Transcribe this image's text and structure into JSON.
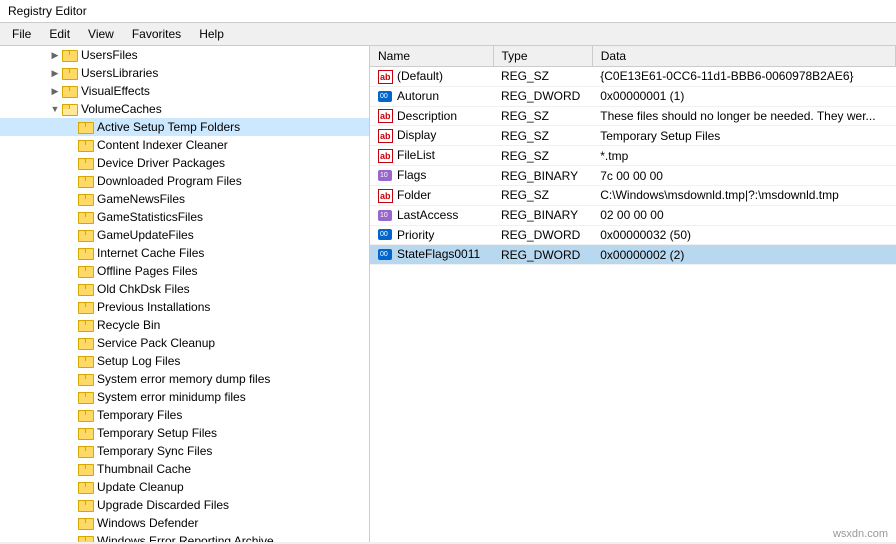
{
  "titleBar": {
    "title": "Registry Editor"
  },
  "menuBar": {
    "items": [
      "File",
      "Edit",
      "View",
      "Favorites",
      "Help"
    ]
  },
  "treePanel": {
    "items": [
      {
        "label": "UsersFiles",
        "indent": 3,
        "arrow": "▶",
        "selected": false
      },
      {
        "label": "UsersLibraries",
        "indent": 3,
        "arrow": "▶",
        "selected": false
      },
      {
        "label": "VisualEffects",
        "indent": 3,
        "arrow": "▶",
        "selected": false
      },
      {
        "label": "VolumeCaches",
        "indent": 3,
        "arrow": "▼",
        "selected": false,
        "open": true
      },
      {
        "label": "Active Setup Temp Folders",
        "indent": 4,
        "arrow": "",
        "selected": true
      },
      {
        "label": "Content Indexer Cleaner",
        "indent": 4,
        "arrow": "",
        "selected": false
      },
      {
        "label": "Device Driver Packages",
        "indent": 4,
        "arrow": "",
        "selected": false
      },
      {
        "label": "Downloaded Program Files",
        "indent": 4,
        "arrow": "",
        "selected": false
      },
      {
        "label": "GameNewsFiles",
        "indent": 4,
        "arrow": "",
        "selected": false
      },
      {
        "label": "GameStatisticsFiles",
        "indent": 4,
        "arrow": "",
        "selected": false
      },
      {
        "label": "GameUpdateFiles",
        "indent": 4,
        "arrow": "",
        "selected": false
      },
      {
        "label": "Internet Cache Files",
        "indent": 4,
        "arrow": "",
        "selected": false
      },
      {
        "label": "Offline Pages Files",
        "indent": 4,
        "arrow": "",
        "selected": false
      },
      {
        "label": "Old ChkDsk Files",
        "indent": 4,
        "arrow": "",
        "selected": false
      },
      {
        "label": "Previous Installations",
        "indent": 4,
        "arrow": "",
        "selected": false
      },
      {
        "label": "Recycle Bin",
        "indent": 4,
        "arrow": "",
        "selected": false
      },
      {
        "label": "Service Pack Cleanup",
        "indent": 4,
        "arrow": "",
        "selected": false
      },
      {
        "label": "Setup Log Files",
        "indent": 4,
        "arrow": "",
        "selected": false
      },
      {
        "label": "System error memory dump files",
        "indent": 4,
        "arrow": "",
        "selected": false
      },
      {
        "label": "System error minidump files",
        "indent": 4,
        "arrow": "",
        "selected": false
      },
      {
        "label": "Temporary Files",
        "indent": 4,
        "arrow": "",
        "selected": false
      },
      {
        "label": "Temporary Setup Files",
        "indent": 4,
        "arrow": "",
        "selected": false
      },
      {
        "label": "Temporary Sync Files",
        "indent": 4,
        "arrow": "",
        "selected": false
      },
      {
        "label": "Thumbnail Cache",
        "indent": 4,
        "arrow": "",
        "selected": false
      },
      {
        "label": "Update Cleanup",
        "indent": 4,
        "arrow": "",
        "selected": false
      },
      {
        "label": "Upgrade Discarded Files",
        "indent": 4,
        "arrow": "",
        "selected": false
      },
      {
        "label": "Windows Defender",
        "indent": 4,
        "arrow": "",
        "selected": false
      },
      {
        "label": "Windows Error Reporting Archive",
        "indent": 4,
        "arrow": "",
        "selected": false
      }
    ]
  },
  "registryTable": {
    "headers": [
      "Name",
      "Type",
      "Data"
    ],
    "rows": [
      {
        "name": "(Default)",
        "type": "REG_SZ",
        "data": "{C0E13E61-0CC6-11d1-BBB6-0060978B2AE6}",
        "iconType": "sz",
        "selected": false
      },
      {
        "name": "Autorun",
        "type": "REG_DWORD",
        "data": "0x00000001 (1)",
        "iconType": "dword",
        "selected": false
      },
      {
        "name": "Description",
        "type": "REG_SZ",
        "data": "These files should no longer be needed. They wer...",
        "iconType": "sz",
        "selected": false
      },
      {
        "name": "Display",
        "type": "REG_SZ",
        "data": "Temporary Setup Files",
        "iconType": "sz",
        "selected": false
      },
      {
        "name": "FileList",
        "type": "REG_SZ",
        "data": "*.tmp",
        "iconType": "sz",
        "selected": false
      },
      {
        "name": "Flags",
        "type": "REG_BINARY",
        "data": "7c 00 00 00",
        "iconType": "binary",
        "selected": false
      },
      {
        "name": "Folder",
        "type": "REG_SZ",
        "data": "C:\\Windows\\msdownld.tmp|?:\\msdownld.tmp",
        "iconType": "sz",
        "selected": false
      },
      {
        "name": "LastAccess",
        "type": "REG_BINARY",
        "data": "02 00 00 00",
        "iconType": "binary",
        "selected": false
      },
      {
        "name": "Priority",
        "type": "REG_DWORD",
        "data": "0x00000032 (50)",
        "iconType": "dword",
        "selected": false
      },
      {
        "name": "StateFlags0011",
        "type": "REG_DWORD",
        "data": "0x00000002 (2)",
        "iconType": "dword",
        "selected": true
      }
    ]
  },
  "watermark": "wsxdn.com"
}
